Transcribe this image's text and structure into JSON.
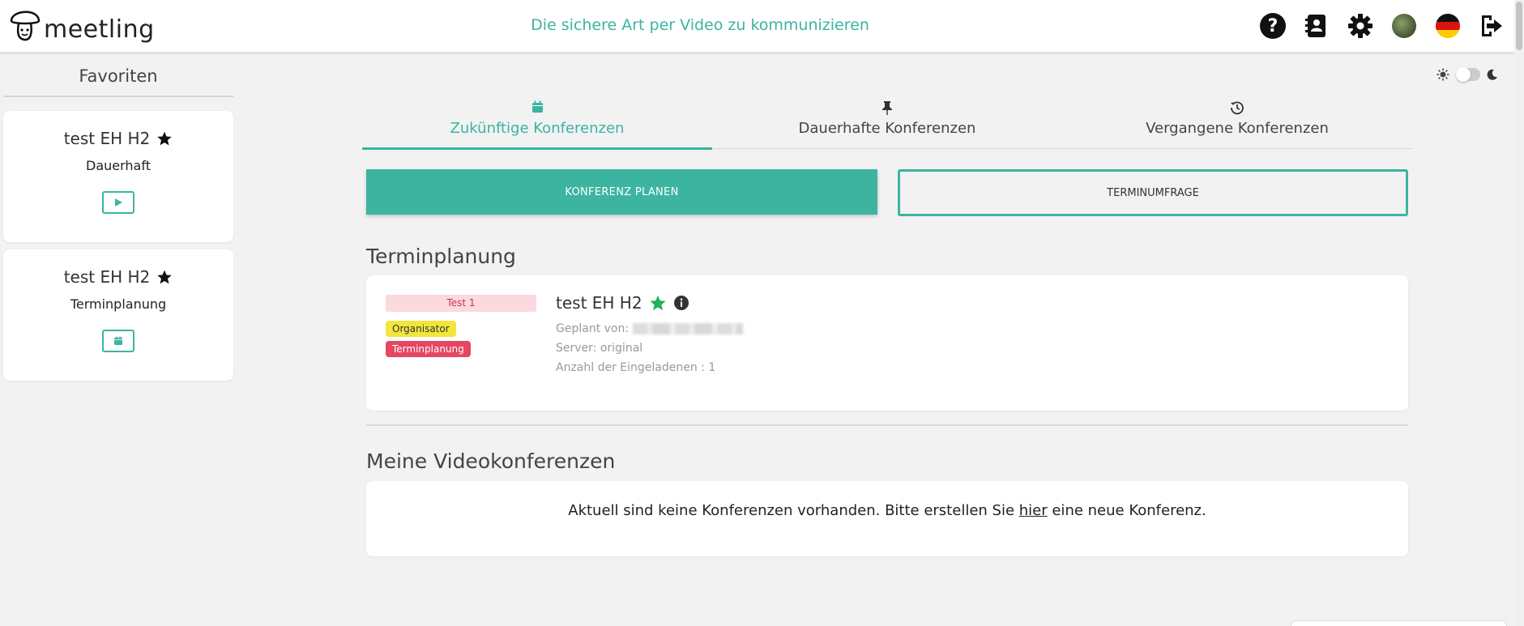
{
  "header": {
    "brand": "meetling",
    "tagline": "Die sichere Art per Video zu kommunizieren",
    "icons": [
      "help-icon",
      "contacts-icon",
      "gear-icon",
      "avatar",
      "german-flag-icon",
      "logout-icon"
    ]
  },
  "sidebar": {
    "title": "Favoriten",
    "favorites": [
      {
        "name": "test EH H2",
        "type": "Dauerhaft",
        "action_icon": "play-icon"
      },
      {
        "name": "test EH H2",
        "type": "Terminplanung",
        "action_icon": "calendar-icon"
      }
    ]
  },
  "theme": {
    "light_icon": "sun-icon",
    "dark_icon": "moon-icon"
  },
  "tabs": [
    {
      "label": "Zukünftige Konferenzen",
      "icon": "calendar-icon",
      "active": true
    },
    {
      "label": "Dauerhafte Konferenzen",
      "icon": "pin-icon",
      "active": false
    },
    {
      "label": "Vergangene Konferenzen",
      "icon": "history-icon",
      "active": false
    }
  ],
  "actions": {
    "plan_label": "KONFERENZ PLANEN",
    "poll_label": "TERMINUMFRAGE"
  },
  "scheduling": {
    "title": "Terminplanung",
    "conference": {
      "tag": "Test 1",
      "badges": [
        "Organisator",
        "Terminplanung"
      ],
      "name": "test EH H2",
      "planned_by_label": "Geplant von:",
      "server": "Server: original",
      "invitees": "Anzahl der Eingeladenen : 1"
    }
  },
  "video": {
    "title": "Meine Videokonferenzen",
    "empty_before": "Aktuell sind keine Konferenzen vorhanden. Bitte erstellen Sie ",
    "empty_link": "hier",
    "empty_after": " eine neue Konferenz."
  },
  "colors": {
    "accent": "#3cb4a0",
    "favorite_star": "#111111",
    "conference_star": "#1fb35a",
    "badge_org": "#f2e53c",
    "badge_plan": "#e44760",
    "badge_test": "#fbd9de"
  }
}
